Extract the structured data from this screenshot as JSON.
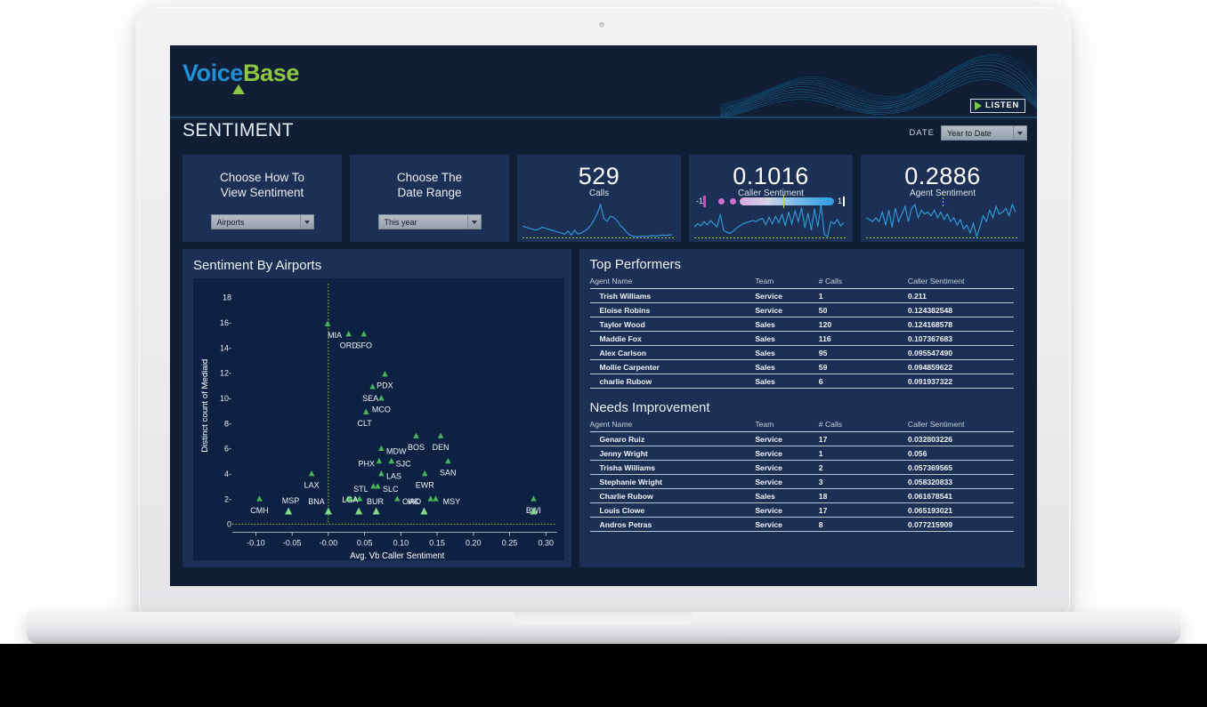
{
  "brand": {
    "logo_voice": "Voice",
    "logo_base": "Base",
    "listen_label": "LISTEN",
    "accent_green": "#8dc63f",
    "accent_blue": "#1f8fd6"
  },
  "header": {
    "page_title": "SENTIMENT",
    "date_label": "DATE",
    "date_value": "Year to Date"
  },
  "filters": [
    {
      "title_line1": "Choose How To",
      "title_line2": "View Sentiment",
      "value": "Airports"
    },
    {
      "title_line1": "Choose The",
      "title_line2": "Date Range",
      "value": "This year"
    }
  ],
  "kpis": [
    {
      "value": "529",
      "label": "Calls"
    },
    {
      "value": "0.1016",
      "label": "Caller Sentiment",
      "slider_min": "-1",
      "slider_max": "1"
    },
    {
      "value": "0.2886",
      "label": "Agent Sentiment"
    }
  ],
  "scatter_panel": {
    "title": "Sentiment By Airports"
  },
  "tables": [
    {
      "title": "Top Performers",
      "columns": [
        "Agent Name",
        "Team",
        "# Calls",
        "Caller Sentiment"
      ],
      "rows": [
        [
          "Trish Williams",
          "Service",
          "1",
          "0.211"
        ],
        [
          "Eloise Robins",
          "Service",
          "50",
          "0.124382548"
        ],
        [
          "Taylor Wood",
          "Sales",
          "120",
          "0.124168578"
        ],
        [
          "Maddie Fox",
          "Sales",
          "116",
          "0.107367683"
        ],
        [
          "Alex Carlson",
          "Sales",
          "95",
          "0.095547490"
        ],
        [
          "Mollie Carpenter",
          "Sales",
          "59",
          "0.094859622"
        ],
        [
          "charlie Rubow",
          "Sales",
          "6",
          "0.091937322"
        ]
      ]
    },
    {
      "title": "Needs Improvement",
      "columns": [
        "Agent Name",
        "Team",
        "# Calls",
        "Caller Sentiment"
      ],
      "rows": [
        [
          "Genaro Ruiz",
          "Service",
          "17",
          "0.032803226"
        ],
        [
          "Jenny Wright",
          "Service",
          "1",
          "0.056"
        ],
        [
          "Trisha Williams",
          "Service",
          "2",
          "0.057369565"
        ],
        [
          "Stephanie Wright",
          "Service",
          "3",
          "0.058320833"
        ],
        [
          "Charlie Rubow",
          "Sales",
          "18",
          "0.061678541"
        ],
        [
          "Louis Clowe",
          "Service",
          "17",
          "0.065193021"
        ],
        [
          "Andros Petras",
          "Service",
          "8",
          "0.077215909"
        ]
      ]
    }
  ],
  "chart_data": {
    "type": "scatter",
    "title": "Sentiment By Airports",
    "xlabel": "Avg. Vb Caller Sentiment",
    "ylabel": "Distinct count of Mediaid",
    "xlim": [
      -0.125,
      0.315
    ],
    "ylim": [
      0,
      18.8
    ],
    "xticks": [
      -0.1,
      -0.05,
      -0.0,
      0.05,
      0.1,
      0.15,
      0.2,
      0.25,
      0.3
    ],
    "xtick_labels": [
      "-0.10",
      "-0.05",
      "-0.00",
      "0.05",
      "0.10",
      "0.15",
      "0.20",
      "0.25",
      "0.30"
    ],
    "yticks": [
      0,
      2,
      4,
      6,
      8,
      10,
      12,
      14,
      16,
      18
    ],
    "ytick_labels": [
      "0",
      "2-",
      "4-",
      "6-",
      "8-",
      "10-",
      "12-",
      "14-",
      "16-",
      "18"
    ],
    "grid": false,
    "reference_line_x": 0.0,
    "marker": "triangle",
    "marker_color": "#49b45a",
    "points": [
      {
        "label": "MIA",
        "x": -0.001,
        "y": 15.9,
        "lx": -0.001,
        "ly": 15.0,
        "anchor": "start"
      },
      {
        "label": "ORD",
        "x": 0.028,
        "y": 15.1,
        "lx": 0.028,
        "ly": 14.2,
        "anchor": "middle"
      },
      {
        "label": "SFO",
        "x": 0.049,
        "y": 15.1,
        "lx": 0.049,
        "ly": 14.2,
        "anchor": "middle"
      },
      {
        "label": "PDX",
        "x": 0.078,
        "y": 11.9,
        "lx": 0.078,
        "ly": 11.0,
        "anchor": "middle"
      },
      {
        "label": "SEA",
        "x": 0.061,
        "y": 10.9,
        "lx": 0.058,
        "ly": 10.0,
        "anchor": "middle"
      },
      {
        "label": "MCO",
        "x": 0.073,
        "y": 10.0,
        "lx": 0.073,
        "ly": 9.1,
        "anchor": "middle"
      },
      {
        "label": "CLT",
        "x": 0.052,
        "y": 8.9,
        "lx": 0.05,
        "ly": 8.0,
        "anchor": "middle"
      },
      {
        "label": "BOS",
        "x": 0.121,
        "y": 7.0,
        "lx": 0.121,
        "ly": 6.1,
        "anchor": "middle"
      },
      {
        "label": "DEN",
        "x": 0.155,
        "y": 7.0,
        "lx": 0.155,
        "ly": 6.1,
        "anchor": "middle"
      },
      {
        "label": "MDW",
        "x": 0.073,
        "y": 6.0,
        "lx": 0.08,
        "ly": 5.8,
        "anchor": "start"
      },
      {
        "label": "PHX",
        "x": 0.07,
        "y": 5.0,
        "lx": 0.064,
        "ly": 4.8,
        "anchor": "end"
      },
      {
        "label": "SJC",
        "x": 0.087,
        "y": 5.0,
        "lx": 0.093,
        "ly": 4.8,
        "anchor": "start"
      },
      {
        "label": "SAN",
        "x": 0.165,
        "y": 5.0,
        "lx": 0.165,
        "ly": 4.1,
        "anchor": "middle"
      },
      {
        "label": "LAX",
        "x": -0.023,
        "y": 4.0,
        "lx": -0.023,
        "ly": 3.1,
        "anchor": "middle"
      },
      {
        "label": "LAS",
        "x": 0.073,
        "y": 4.0,
        "lx": 0.08,
        "ly": 3.8,
        "anchor": "start"
      },
      {
        "label": "EWR",
        "x": 0.133,
        "y": 4.0,
        "lx": 0.133,
        "ly": 3.1,
        "anchor": "middle"
      },
      {
        "label": "SLC",
        "x": 0.068,
        "y": 3.0,
        "lx": 0.075,
        "ly": 2.8,
        "anchor": "start"
      },
      {
        "label": "STL",
        "x": 0.062,
        "y": 3.0,
        "lx": 0.055,
        "ly": 2.8,
        "anchor": "end"
      },
      {
        "label": "CMH",
        "x": -0.095,
        "y": 2.0,
        "lx": -0.095,
        "ly": 1.1,
        "anchor": "middle"
      },
      {
        "label": "OAK",
        "x": 0.095,
        "y": 2.0,
        "lx": 0.102,
        "ly": 1.8,
        "anchor": "start"
      },
      {
        "label": "MSY",
        "x": 0.148,
        "y": 2.0,
        "lx": 0.158,
        "ly": 1.8,
        "anchor": "start"
      },
      {
        "label": "BWI",
        "x": 0.283,
        "y": 2.0,
        "lx": 0.283,
        "ly": 1.1,
        "anchor": "middle"
      },
      {
        "label": "",
        "x": 0.037,
        "y": 2.0,
        "lx": 0,
        "ly": 0,
        "anchor": "middle"
      },
      {
        "label": "",
        "x": 0.043,
        "y": 2.0,
        "lx": 0,
        "ly": 0,
        "anchor": "middle"
      },
      {
        "label": "",
        "x": 0.141,
        "y": 2.0,
        "lx": 0,
        "ly": 0,
        "anchor": "middle"
      },
      {
        "label": "",
        "x": 0.03,
        "y": 2.0,
        "lx": 0,
        "ly": 0,
        "anchor": "middle"
      },
      {
        "label": "LGA",
        "x": 0.027,
        "y": 2.0,
        "lx": 0.019,
        "ly": 1.95,
        "anchor": "start"
      },
      {
        "label": "BNA",
        "x": 0.0,
        "y": 1.0,
        "lx": -0.005,
        "ly": 1.8,
        "anchor": "end"
      },
      {
        "label": "BUR",
        "x": 0.066,
        "y": 1.0,
        "lx": 0.053,
        "ly": 1.8,
        "anchor": "start"
      },
      {
        "label": "MSP",
        "x": -0.055,
        "y": 1.0,
        "lx": -0.052,
        "ly": 1.85,
        "anchor": "middle"
      },
      {
        "label": "IAD",
        "x": 0.132,
        "y": 1.0,
        "lx": 0.128,
        "ly": 1.8,
        "anchor": "end"
      },
      {
        "label": "",
        "x": 0.042,
        "y": 1.0,
        "lx": 0,
        "ly": 0,
        "anchor": "middle"
      },
      {
        "label": "",
        "x": 0.283,
        "y": 1.0,
        "lx": 0,
        "ly": 0,
        "anchor": "middle"
      }
    ]
  },
  "sparklines": {
    "calls": [
      28,
      26,
      24,
      22,
      20,
      22,
      26,
      24,
      22,
      20,
      18,
      16,
      14,
      12,
      18,
      10,
      20,
      12,
      14,
      18,
      22,
      30,
      40,
      54,
      72,
      44,
      38,
      48,
      46,
      40,
      30,
      24,
      16,
      10,
      8,
      7,
      7,
      8,
      7,
      8,
      9,
      8,
      9,
      10,
      9,
      10,
      11
    ],
    "caller": [
      20,
      26,
      22,
      30,
      24,
      32,
      26,
      20,
      44,
      14,
      10,
      8,
      12,
      18,
      22,
      26,
      28,
      30,
      32,
      30,
      34,
      36,
      24,
      38,
      26,
      40,
      28,
      44,
      22,
      48,
      26,
      50,
      30,
      56,
      18,
      46,
      14,
      54,
      20,
      62,
      6,
      2,
      30,
      26,
      34,
      22,
      28
    ],
    "agent": [
      34,
      32,
      30,
      34,
      30,
      40,
      26,
      42,
      24,
      44,
      30,
      38,
      46,
      30,
      44,
      48,
      34,
      42,
      38,
      40,
      36,
      42,
      34,
      40,
      32,
      38,
      30,
      34,
      26,
      32,
      22,
      26,
      18,
      28,
      14,
      24,
      36,
      30,
      42,
      34,
      46,
      38,
      40,
      44,
      36,
      48,
      40
    ]
  }
}
